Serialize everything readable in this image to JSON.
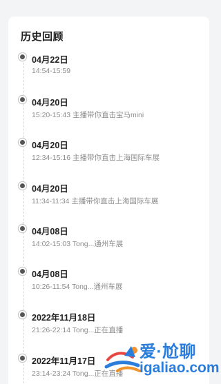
{
  "history": {
    "title": "历史回顾",
    "entries": [
      {
        "date": "04月22日",
        "detail": "14:54-15:59"
      },
      {
        "date": "04月20日",
        "detail": "15:20-15:43 主播带你直击宝马mini"
      },
      {
        "date": "04月20日",
        "detail": "12:34-15:16 主播带你直击上海国际车展"
      },
      {
        "date": "04月20日",
        "detail": "11:34-11:34 主播带你直击上海国际车展"
      },
      {
        "date": "04月08日",
        "detail": "14:02-15:03 Tong...通州车展"
      },
      {
        "date": "04月08日",
        "detail": "10:26-11:54 Tong...通州车展"
      },
      {
        "date": "2022年11月18日",
        "detail": "21:26-22:14 Tong...正在直播"
      },
      {
        "date": "2022年11月17日",
        "detail": "23:14-23:24 Tong...正在直播"
      }
    ]
  },
  "watermark": {
    "title": "爱·尬聊",
    "url": "igaliao.com",
    "colors": {
      "blue": "#1a73d9",
      "orange": "#f08a1c",
      "red": "#e53935"
    }
  },
  "colors": {
    "page_bg": "#f3f4f6",
    "card_bg": "#ffffff",
    "date_text": "#222222",
    "detail_text": "#8d8d8d"
  }
}
